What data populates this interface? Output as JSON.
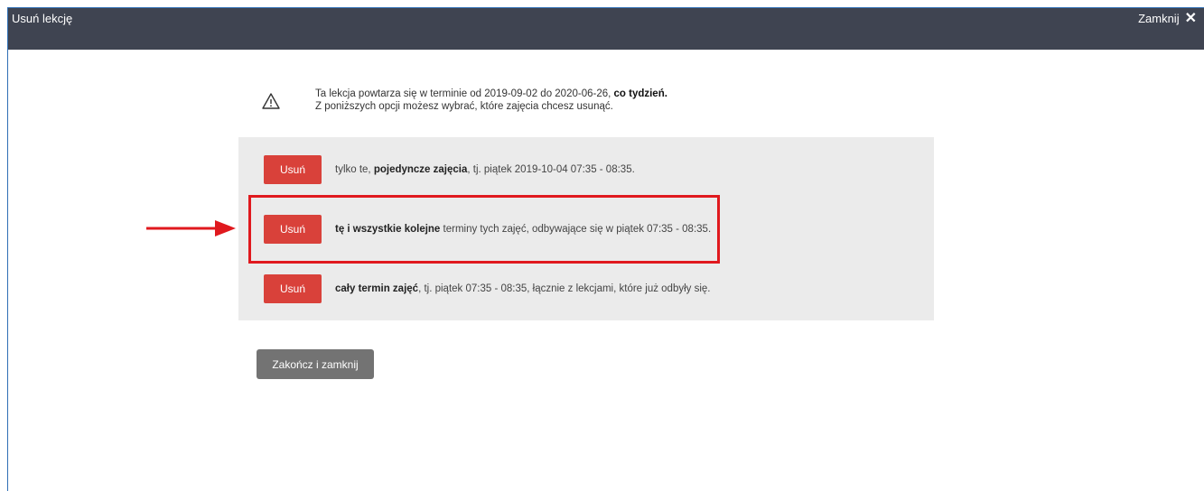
{
  "titlebar": {
    "title": "Usuń lekcję",
    "close_label": "Zamknij",
    "close_icon": "close-icon",
    "bg_color": "#3f4451"
  },
  "warning": {
    "icon": "warning-icon",
    "line1_pre": "Ta lekcja powtarza się w terminie od 2019-09-02 do 2020-06-26, ",
    "line1_bold": "co tydzień.",
    "line2": "Z poniższych opcji możesz wybrać, które zajęcia chcesz usunąć."
  },
  "options": [
    {
      "button_label": "Usuń",
      "text_pre": "tylko te, ",
      "text_bold": "pojedyncze zajęcia",
      "text_post": ", tj. piątek 2019-10-04 07:35 - 08:35."
    },
    {
      "button_label": "Usuń",
      "text_pre": "",
      "text_bold": "tę i wszystkie kolejne",
      "text_post": " terminy tych zajęć, odbywające się w piątek 07:35 - 08:35."
    },
    {
      "button_label": "Usuń",
      "text_pre": "",
      "text_bold": "cały termin zajęć",
      "text_post": ", tj. piątek 07:35 - 08:35, łącznie z lekcjami, które już odbyły się."
    }
  ],
  "finish_button": "Zakończ i zamknij",
  "colors": {
    "danger": "#d9413a",
    "highlight": "#e0191e",
    "neutral_button": "#737373",
    "panel_bg": "#ebebeb"
  }
}
